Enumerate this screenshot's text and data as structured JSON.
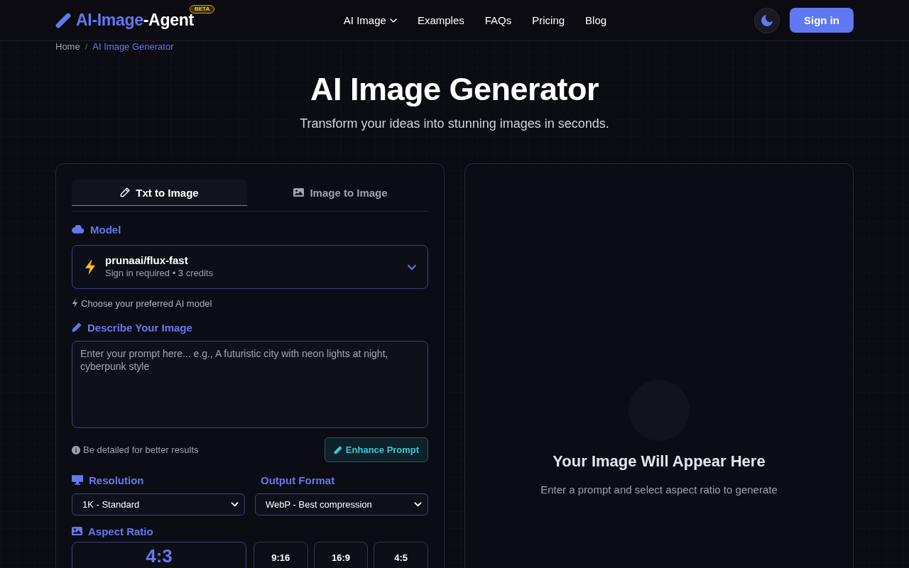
{
  "header": {
    "logo": {
      "accent": "AI-Image",
      "rest": "-Agent",
      "badge": "BETA"
    },
    "nav": [
      {
        "label": "AI Image",
        "dropdown": true
      },
      {
        "label": "Examples",
        "dropdown": false
      },
      {
        "label": "FAQs",
        "dropdown": false
      },
      {
        "label": "Pricing",
        "dropdown": false
      },
      {
        "label": "Blog",
        "dropdown": false
      }
    ],
    "theme_toggle": {
      "dark": true
    },
    "sign_in": "Sign in"
  },
  "breadcrumb": {
    "separator": "/",
    "items": [
      {
        "label": "Home",
        "current": false
      },
      {
        "label": "AI Image Generator",
        "current": true
      }
    ]
  },
  "hero": {
    "title": "AI Image Generator",
    "subtitle": "Transform your ideas into stunning images in seconds."
  },
  "generator": {
    "tabs": [
      {
        "kind": "text",
        "label": "Txt to Image",
        "selected": true
      },
      {
        "kind": "image",
        "label": "Image to Image",
        "selected": false
      }
    ],
    "model": {
      "label": "Model",
      "name": "prunaai/flux-fast",
      "detail": "Sign in required • 3 credits",
      "hint": "Choose your preferred AI model"
    },
    "prompt": {
      "label": "Describe Your Image",
      "placeholder": "Enter your prompt here... e.g., A futuristic city with neon lights at night, cyberpunk style",
      "tip": "Be detailed for better results",
      "enhance_button": "Enhance Prompt"
    },
    "resolution": {
      "label": "Resolution",
      "value": "1K - Standard"
    },
    "output_format": {
      "label": "Output Format",
      "value": "WebP - Best compression"
    },
    "aspect_ratio": {
      "label": "Aspect Ratio",
      "options": [
        {
          "ratio": "4:3",
          "selected": true
        },
        {
          "ratio": "9:16",
          "selected": false
        },
        {
          "ratio": "16:9",
          "selected": false
        },
        {
          "ratio": "4:5",
          "selected": false
        }
      ]
    }
  },
  "preview": {
    "title": "Your Image Will Appear Here",
    "subtitle": "Enter a prompt and select aspect ratio to generate"
  }
}
